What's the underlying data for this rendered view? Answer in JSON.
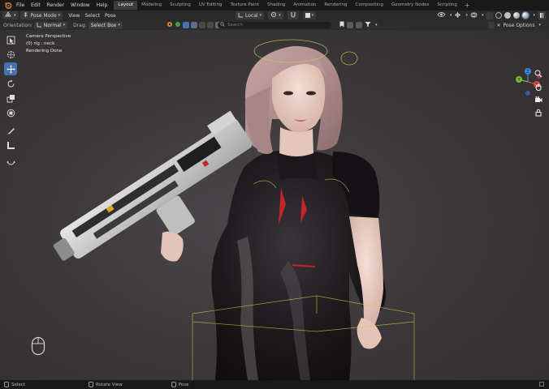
{
  "menu": {
    "items": [
      "File",
      "Edit",
      "Render",
      "Window",
      "Help"
    ]
  },
  "workspace_tabs": {
    "items": [
      "Layout",
      "Modeling",
      "Sculpting",
      "UV Editing",
      "Texture Paint",
      "Shading",
      "Animation",
      "Rendering",
      "Compositing",
      "Geometry Nodes",
      "Scripting"
    ],
    "active": "Layout",
    "add_label": "+"
  },
  "viewport_header": {
    "mode": "Pose Mode",
    "menus": [
      "View",
      "Select",
      "Pose"
    ],
    "pivot": "Local"
  },
  "tool_settings": {
    "orientation_label": "Orientation:",
    "orientation_value": "Normal",
    "drag_label": "Drag:",
    "drag_value": "Select Box",
    "search_placeholder": "Search",
    "pose_options": "Pose Options"
  },
  "overlay": {
    "line1": "Camera Perspective",
    "line2": "(0) rig : neck",
    "line3": "Rendering Done"
  },
  "gizmo": {
    "x": "X",
    "y": "Y",
    "z": "Z"
  },
  "status_bar": {
    "items": [
      "Select",
      "Rotate View",
      "Pose"
    ]
  },
  "colors": {
    "active_tool": "#4772b3",
    "axis_x": "#e04848",
    "axis_y": "#7ab935",
    "axis_z": "#3f86e0"
  }
}
